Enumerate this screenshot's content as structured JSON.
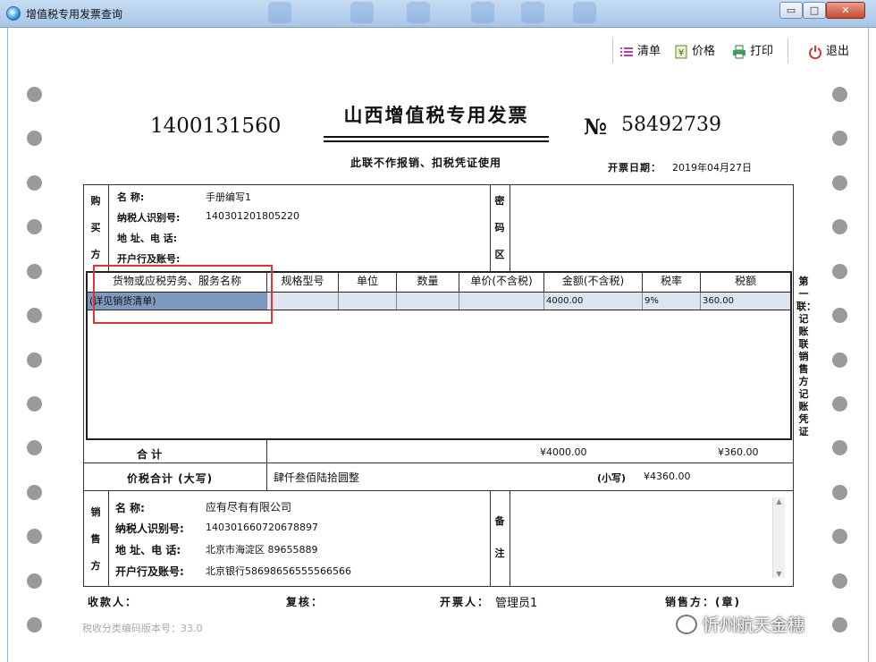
{
  "window": {
    "title": "增值税专用发票查询",
    "min": "▭",
    "max": "□",
    "close": "✕"
  },
  "toolbar": {
    "list_label": "清单",
    "price_label": "价格",
    "print_label": "打印",
    "exit_label": "退出"
  },
  "invoice": {
    "title": "山西增值税专用发票",
    "code": "1400131560",
    "no_mark": "№",
    "number": "58492739",
    "note": "此联不作报销、扣税凭证使用",
    "date_label": "开票日期：",
    "date": "2019年04月27日",
    "buyer": {
      "side_label": [
        "购",
        "买",
        "方"
      ],
      "name_label": "名        称:",
      "name": "手册编写1",
      "tax_id_label": "纳税人识别号:",
      "tax_id": "140301201805220",
      "addr_label": "地 址、电 话:",
      "addr": "",
      "bank_label": "开户行及账号:",
      "bank": ""
    },
    "cipher_label": [
      "密",
      "码",
      "区"
    ],
    "columns": [
      "货物或应税劳务、服务名称",
      "规格型号",
      "单位",
      "数量",
      "单价(不含税)",
      "金额(不含税)",
      "税率",
      "税额"
    ],
    "rows": [
      [
        "(详见销货清单)",
        "",
        "",
        "",
        "",
        "4000.00",
        "9%",
        "360.00"
      ]
    ],
    "total_label": "合          计",
    "total_amount": "¥4000.00",
    "total_tax": "¥360.00",
    "sum_label": "价税合计 (大写)",
    "sum_upper": "肆仟叁佰陆拾圆整",
    "sum_small_label": "(小写)",
    "sum_small": "¥4360.00",
    "seller": {
      "side_label": [
        "销",
        "售",
        "方"
      ],
      "name_label": "名        称:",
      "name": "应有尽有有限公司",
      "tax_id_label": "纳税人识别号:",
      "tax_id": "140301660720678897",
      "addr_label": "地 址、电 话:",
      "addr": "北京市海淀区 89655889",
      "bank_label": "开户行及账号:",
      "bank": "北京银行58698656555566566"
    },
    "remark_label": [
      "备",
      "注"
    ],
    "side_text": "第一联：记账联 销售方记账凭证",
    "payee_label": "收款人：",
    "reviewer_label": "复核：",
    "issuer_label": "开票人：",
    "issuer": "管理员1",
    "seller_seal_label": "销售方：(章)",
    "version": "税收分类编码版本号：33.0"
  },
  "watermark": "忻州航天金穗"
}
